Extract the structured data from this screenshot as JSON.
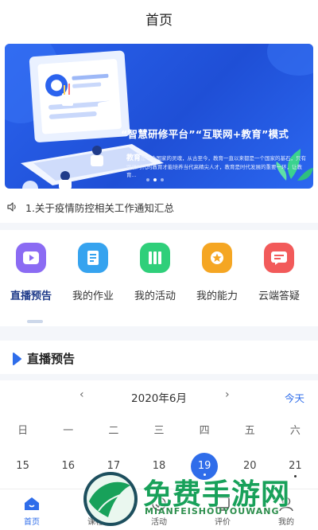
{
  "header": {
    "title": "首页"
  },
  "banner": {
    "headline": "“智慧研修平台”“互联网+教育”模式",
    "para_lead": "教育",
    "para_body": "是一个国家的灵魂，从古至今，教育一直以来都是一个国家的基石，只有跟紧时代的教育才能培养当代高精尖人才，教育是时代发展的重要一环，让教育..."
  },
  "notice": {
    "text": "1.关于疫情防控相关工作通知汇总"
  },
  "quick_links": [
    {
      "label": "直播预告",
      "icon": "live-play-icon",
      "color": "#8b6bf3"
    },
    {
      "label": "我的作业",
      "icon": "homework-book-icon",
      "color": "#36a3ef"
    },
    {
      "label": "我的活动",
      "icon": "activity-books-icon",
      "color": "#2fcf7a"
    },
    {
      "label": "我的能力",
      "icon": "ability-medal-icon",
      "color": "#f5a623"
    },
    {
      "label": "云端答疑",
      "icon": "cloud-qa-icon",
      "color": "#f25a5a"
    }
  ],
  "section": {
    "title": "直播预告"
  },
  "calendar": {
    "month": "2020年6月",
    "prev": "‹",
    "next": "›",
    "today": "今天",
    "weekdays": [
      "日",
      "一",
      "二",
      "三",
      "四",
      "五",
      "六"
    ],
    "dates": [
      "15",
      "16",
      "17",
      "18",
      "19",
      "20",
      "21"
    ],
    "selected": "19"
  },
  "tabbar": [
    {
      "label": "首页",
      "icon": "home-icon"
    },
    {
      "label": "课程",
      "icon": "course-icon"
    },
    {
      "label": "活动",
      "icon": "activity-icon"
    },
    {
      "label": "评价",
      "icon": "evaluation-icon"
    },
    {
      "label": "我的",
      "icon": "profile-icon"
    }
  ],
  "watermark": {
    "main": "免费手游网",
    "sub": "MIANFEISHOUYOUWANG"
  },
  "colors": {
    "accent": "#2f6dea",
    "banner": "#2560eb"
  }
}
